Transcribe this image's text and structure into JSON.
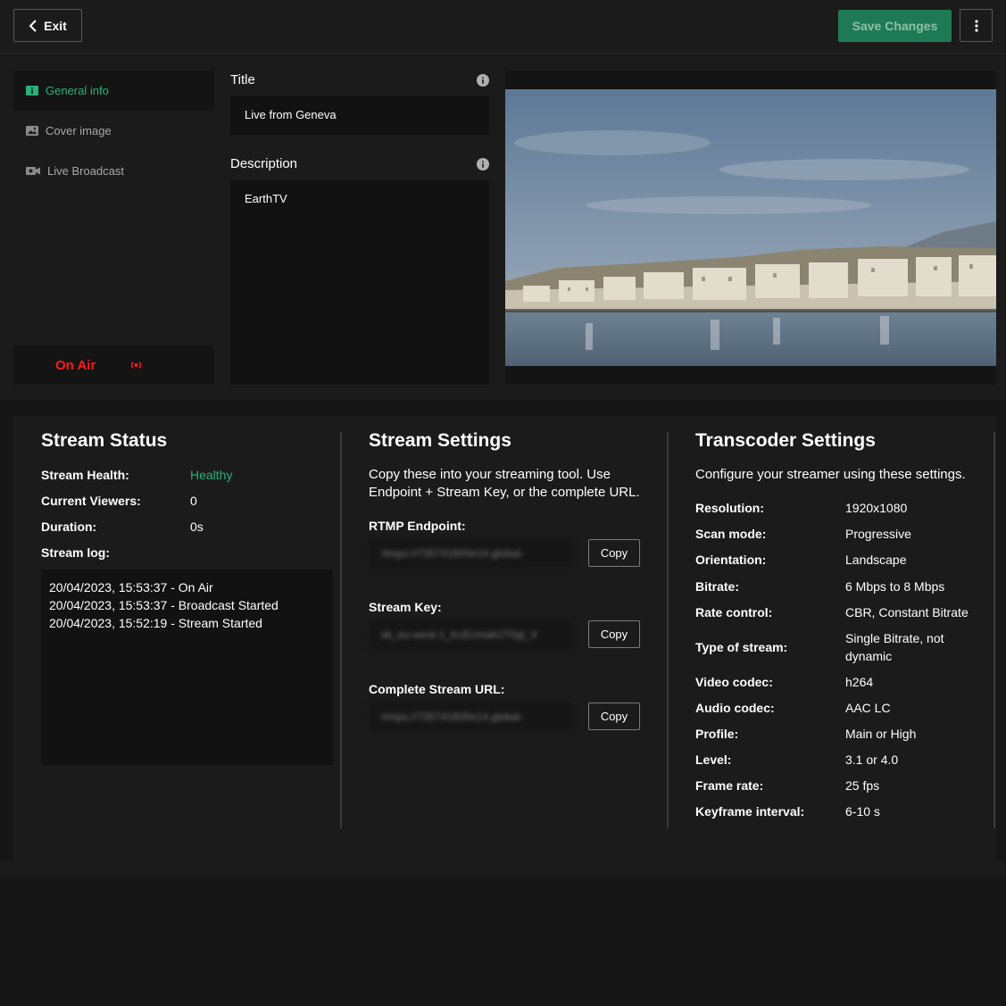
{
  "header": {
    "exit_label": "Exit",
    "save_label": "Save Changes"
  },
  "sidebar": {
    "items": [
      {
        "label": "General info",
        "icon": "info-square-icon",
        "active": true
      },
      {
        "label": "Cover image",
        "icon": "image-icon",
        "active": false
      },
      {
        "label": "Live Broadcast",
        "icon": "video-camera-icon",
        "active": false
      }
    ],
    "on_air_label": "On Air"
  },
  "form": {
    "title_label": "Title",
    "title_value": "Live from Geneva",
    "description_label": "Description",
    "description_value": "EarthTV"
  },
  "stream_status": {
    "title": "Stream Status",
    "health_label": "Stream Health:",
    "health_value": "Healthy",
    "viewers_label": "Current Viewers:",
    "viewers_value": "0",
    "duration_label": "Duration:",
    "duration_value": "0s",
    "log_label": "Stream log:",
    "log": [
      "20/04/2023, 15:53:37 - On Air",
      "20/04/2023, 15:53:37 - Broadcast Started",
      "20/04/2023, 15:52:19 - Stream Started"
    ]
  },
  "stream_settings": {
    "title": "Stream Settings",
    "description": "Copy these into your streaming tool. Use Endpoint + Stream Key, or the complete URL.",
    "copy_label": "Copy",
    "rtmp_label": "RTMP Endpoint:",
    "rtmp_value": "rtmps://735741600e14.global-",
    "key_label": "Stream Key:",
    "key_value": "sk_eu-west-1_KcEcmakUT0gl_V",
    "url_label": "Complete Stream URL:",
    "url_value": "rtmps://735741600e14.global-"
  },
  "transcoder": {
    "title": "Transcoder Settings",
    "description": "Configure your streamer using these settings.",
    "rows": [
      {
        "label": "Resolution:",
        "value": "1920x1080"
      },
      {
        "label": "Scan mode:",
        "value": "Progressive"
      },
      {
        "label": "Orientation:",
        "value": "Landscape"
      },
      {
        "label": "Bitrate:",
        "value": "6 Mbps to 8 Mbps"
      },
      {
        "label": "Rate control:",
        "value": "CBR, Constant Bitrate"
      },
      {
        "label": "Type of stream:",
        "value": "Single Bitrate, not dynamic"
      },
      {
        "label": "Video codec:",
        "value": "h264"
      },
      {
        "label": "Audio codec:",
        "value": "AAC LC"
      },
      {
        "label": "Profile:",
        "value": "Main or High"
      },
      {
        "label": "Level:",
        "value": "3.1 or 4.0"
      },
      {
        "label": "Frame rate:",
        "value": "25 fps"
      },
      {
        "label": "Keyframe interval:",
        "value": "6-10 s"
      }
    ]
  },
  "colors": {
    "accent_green": "#29b07c",
    "save_button": "#1e7a56",
    "on_air_red": "#ff1a1a"
  }
}
